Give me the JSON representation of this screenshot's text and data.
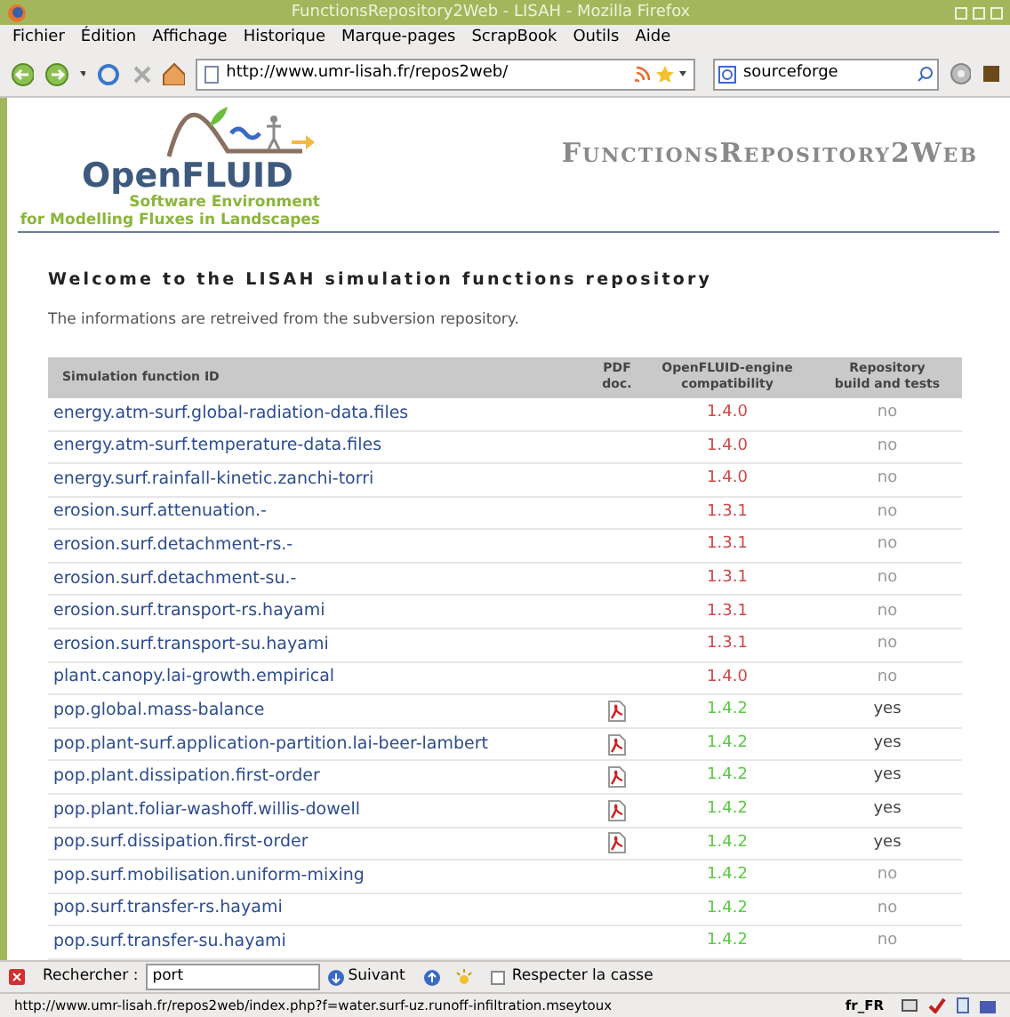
{
  "window": {
    "title": "FunctionsRepository2Web - LISAH - Mozilla Firefox"
  },
  "menu": [
    "Fichier",
    "Édition",
    "Affichage",
    "Historique",
    "Marque-pages",
    "ScrapBook",
    "Outils",
    "Aide"
  ],
  "toolbar": {
    "url": "http://www.umr-lisah.fr/repos2web/",
    "search": "sourceforge"
  },
  "page": {
    "logo_title": "OpenFLUID",
    "logo_line1": "Software Environment",
    "logo_line2": "for Modelling Fluxes in Landscapes",
    "site_title": "FunctionsRepository2Web",
    "heading": "Welcome to the LISAH simulation functions repository",
    "intro": "The informations are retreived from the subversion repository.",
    "table": {
      "columns": [
        "Simulation function ID",
        "PDF doc.",
        "OpenFLUID-engine compatibility",
        "Repository build and tests"
      ],
      "rows": [
        {
          "id": "energy.atm-surf.global-radiation-data.files",
          "pdf": false,
          "compat": "1.4.0",
          "compatible": false,
          "build": "no"
        },
        {
          "id": "energy.atm-surf.temperature-data.files",
          "pdf": false,
          "compat": "1.4.0",
          "compatible": false,
          "build": "no"
        },
        {
          "id": "energy.surf.rainfall-kinetic.zanchi-torri",
          "pdf": false,
          "compat": "1.4.0",
          "compatible": false,
          "build": "no"
        },
        {
          "id": "erosion.surf.attenuation.-",
          "pdf": false,
          "compat": "1.3.1",
          "compatible": false,
          "build": "no"
        },
        {
          "id": "erosion.surf.detachment-rs.-",
          "pdf": false,
          "compat": "1.3.1",
          "compatible": false,
          "build": "no"
        },
        {
          "id": "erosion.surf.detachment-su.-",
          "pdf": false,
          "compat": "1.3.1",
          "compatible": false,
          "build": "no"
        },
        {
          "id": "erosion.surf.transport-rs.hayami",
          "pdf": false,
          "compat": "1.3.1",
          "compatible": false,
          "build": "no"
        },
        {
          "id": "erosion.surf.transport-su.hayami",
          "pdf": false,
          "compat": "1.3.1",
          "compatible": false,
          "build": "no"
        },
        {
          "id": "plant.canopy.lai-growth.empirical",
          "pdf": false,
          "compat": "1.4.0",
          "compatible": false,
          "build": "no"
        },
        {
          "id": "pop.global.mass-balance",
          "pdf": true,
          "compat": "1.4.2",
          "compatible": true,
          "build": "yes"
        },
        {
          "id": "pop.plant-surf.application-partition.lai-beer-lambert",
          "pdf": true,
          "compat": "1.4.2",
          "compatible": true,
          "build": "yes"
        },
        {
          "id": "pop.plant.dissipation.first-order",
          "pdf": true,
          "compat": "1.4.2",
          "compatible": true,
          "build": "yes"
        },
        {
          "id": "pop.plant.foliar-washoff.willis-dowell",
          "pdf": true,
          "compat": "1.4.2",
          "compatible": true,
          "build": "yes"
        },
        {
          "id": "pop.surf.dissipation.first-order",
          "pdf": true,
          "compat": "1.4.2",
          "compatible": true,
          "build": "yes"
        },
        {
          "id": "pop.surf.mobilisation.uniform-mixing",
          "pdf": false,
          "compat": "1.4.2",
          "compatible": true,
          "build": "no"
        },
        {
          "id": "pop.surf.transfer-rs.hayami",
          "pdf": false,
          "compat": "1.4.2",
          "compatible": true,
          "build": "no"
        },
        {
          "id": "pop.surf.transfer-su.hayami",
          "pdf": false,
          "compat": "1.4.2",
          "compatible": true,
          "build": "no"
        }
      ]
    }
  },
  "findbar": {
    "label": "Rechercher :",
    "value": "port",
    "next": "Suivant",
    "match_case": {
      "label": "Respecter la casse",
      "checked": false
    }
  },
  "status_bar": {
    "url": "http://www.umr-lisah.fr/repos2web/index.php?f=water.surf-uz.runoff-infiltration.mseytoux",
    "locale": "fr_FR"
  }
}
